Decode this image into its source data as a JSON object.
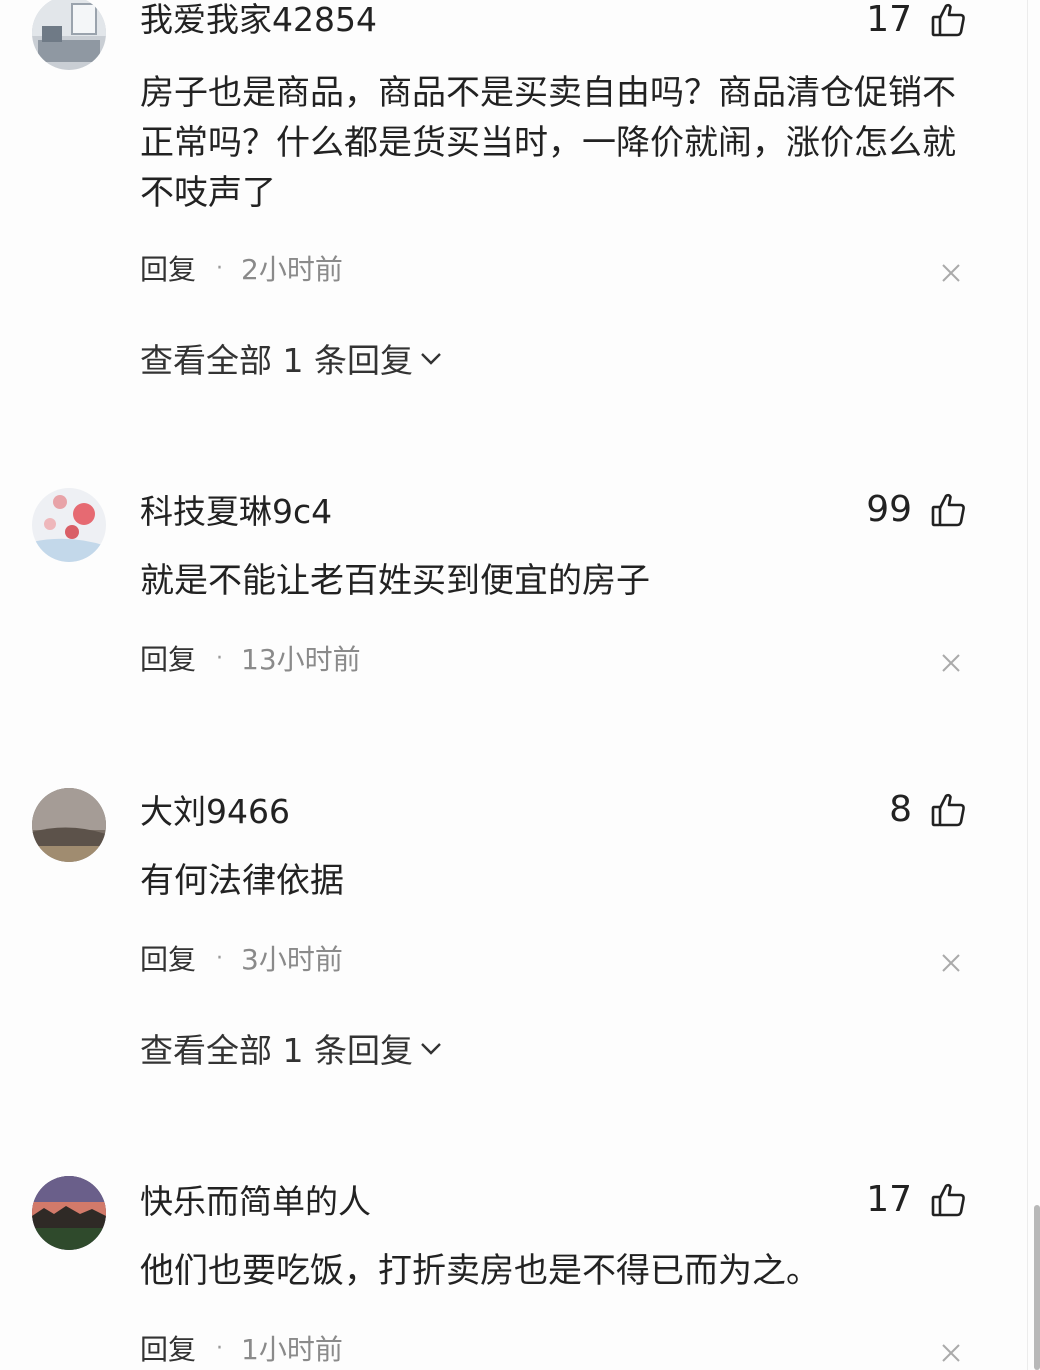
{
  "comments": [
    {
      "username": "我爱我家42854",
      "likes": "17",
      "text": "房子也是商品，商品不是买卖自由吗？商品清仓促销不正常吗？什么都是货买当时，一降价就闹，涨价怎么就不吱声了",
      "reply_label": "回复",
      "separator": "·",
      "time": "2小时前",
      "view_replies": "查看全部 1 条回复"
    },
    {
      "username": "科技夏琳9c4",
      "likes": "99",
      "text": "就是不能让老百姓买到便宜的房子",
      "reply_label": "回复",
      "separator": "·",
      "time": "13小时前"
    },
    {
      "username": "大刘9466",
      "likes": "8",
      "text": "有何法律依据",
      "reply_label": "回复",
      "separator": "·",
      "time": "3小时前",
      "view_replies": "查看全部 1 条回复"
    },
    {
      "username": "快乐而简单的人",
      "likes": "17",
      "text": "他们也要吃饭，打折卖房也是不得已而为之。",
      "reply_label": "回复",
      "separator": "·",
      "time": "1小时前"
    }
  ],
  "icons": {
    "like": "thumbs-up-icon",
    "close": "close-icon",
    "expand": "chevron-down-icon"
  },
  "colors": {
    "text": "#222222",
    "meta": "#8a8a8a",
    "background": "#fdfdfd"
  }
}
